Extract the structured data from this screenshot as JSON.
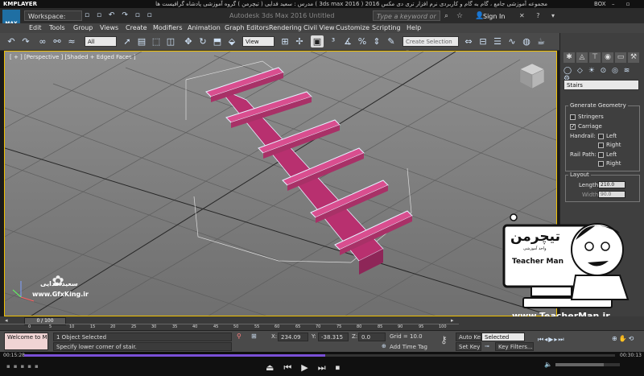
{
  "kmplayer": {
    "brand": "KMPLAYER",
    "course_title": "مجموعه آموزشی جامع ، گام به گام و کاربردی نرم افزار تری دی مکس 2016 ( 3ds max 2016 ) مدرس : سعید فدایی ( تیچرمن ) گروه آموزشی پادشاه گرافیست ها",
    "box_label": "BOX"
  },
  "title_bar": {
    "app_badge": "MAX",
    "workspace": "Workspace: Default",
    "window_title": "Autodesk 3ds Max 2016    Untitled",
    "search_placeholder": "Type a keyword or phrase",
    "sign_in": "Sign In"
  },
  "menu": [
    "Edit",
    "Tools",
    "Group",
    "Views",
    "Create",
    "Modifiers",
    "Animation",
    "Graph Editors",
    "Rendering",
    "Civil View",
    "Customize",
    "Scripting",
    "Help"
  ],
  "toolbar": {
    "filter": "All",
    "ref_coord": "View",
    "selection_set": "Create Selection Se"
  },
  "viewport": {
    "label": "[ + ] [Perspective ] [Shaded + Edged Faces ]"
  },
  "command_panel": {
    "object_type": "Stairs",
    "generate_geometry_title": "Generate Geometry",
    "stringers": "Stringers",
    "carriage": "Carriage",
    "carriage_checked": true,
    "handrail_label": "Handrail:",
    "rail_path_label": "Rail Path:",
    "left": "Left",
    "right": "Right",
    "layout_title": "Layout",
    "length_label": "Length:",
    "length_value": "210.0",
    "width_label": "Width:",
    "width_value": "90.0"
  },
  "timeline": {
    "frame": "0 / 100",
    "ticks": [
      "0",
      "5",
      "10",
      "15",
      "20",
      "25",
      "30",
      "35",
      "40",
      "45",
      "50",
      "55",
      "60",
      "65",
      "70",
      "75",
      "80",
      "85",
      "90",
      "95",
      "100"
    ]
  },
  "status": {
    "maxscript": "Welcome to M:",
    "selection": "1 Object Selected",
    "prompt": "Specify lower corner of stair.",
    "x_label": "X:",
    "x_value": "234.09",
    "y_label": "Y:",
    "y_value": "-38.315",
    "z_label": "Z:",
    "z_value": "0.0",
    "grid": "Grid = 10.0",
    "add_time_tag": "Add Time Tag",
    "auto_key": "Auto Key",
    "selected": "Selected",
    "set_key": "Set Key",
    "key_filters": "Key Filters..."
  },
  "player": {
    "elapsed": "00:15:28",
    "total": "00:30:13",
    "progress": 0.51
  },
  "watermarks": {
    "gfx_name": "سعید فدایی",
    "gfx_site": "www.GfxKing.ir",
    "teacher_fa": "تیچرمن",
    "teacher_sub": "واحد آموزشی",
    "teacher_en": "Teacher Man",
    "teacher_site": "www.TeacherMan.ir"
  },
  "colors": {
    "stair": "#d94e8f",
    "highlight": "#e7f0ff",
    "selection_border": "#f0c000"
  }
}
